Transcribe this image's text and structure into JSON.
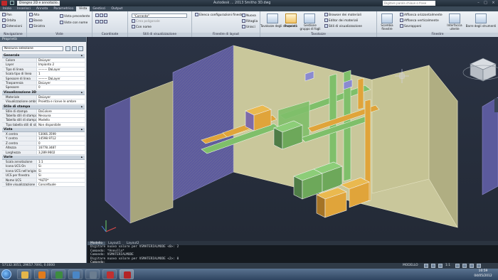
{
  "titlebar": {
    "workspace": "Disegno 2D e annotazio...",
    "title": "Autodesk ... 2013   Smitho 3D.dwg",
    "search_placeholder": "Digitare parola chiave o frase"
  },
  "tabs": [
    "Inizio",
    "Inserisci",
    "Annota",
    "Parametrico",
    "Vista",
    "Gestisci",
    "Output"
  ],
  "active_tab": "Vista",
  "ribbon": {
    "navigation": {
      "title": "Navigazione",
      "items": [
        "Pan",
        "Orbita",
        "Estensioni"
      ]
    },
    "views": {
      "title": "Viste",
      "items": [
        "Alto",
        "Basso",
        "Sinistra"
      ],
      "extras": [
        "Vista precedente",
        "Viste con nome"
      ]
    },
    "coords": {
      "title": "Coordinate"
    },
    "visual": {
      "title": "Stili di visualizzazione",
      "style": "\"Corrente\"",
      "items": [
        "Crea poligonale",
        "Con nome"
      ]
    },
    "viewports": {
      "title": "Finestre di layout",
      "items": [
        "Elenco configurazioni finestra",
        "Nuova",
        "Ritaglia",
        "Unisci"
      ]
    },
    "palettes": {
      "title": "Tavolozze",
      "items": [
        "Tavolozze degli strumenti",
        "Proprietà",
        "Gestione gruppo di fogli"
      ],
      "list": [
        "Browser dei materiali",
        "Editor dei materiali",
        "Stili di visualizzazione"
      ]
    },
    "windows": {
      "title": "Finestre",
      "items": [
        "Scambia finestre",
        "Affianca orizzontalmente",
        "Affianca verticalmente",
        "Sovrapponi",
        "Interfaccia utente",
        "Barre degli strumenti"
      ]
    }
  },
  "palette": {
    "title": "Proprietà",
    "selection": "Nessuna selezione",
    "sections": [
      {
        "name": "Generale",
        "rows": [
          [
            "Colore",
            "DaLayer"
          ],
          [
            "Layer",
            "Impianto 2"
          ],
          [
            "Tipo di linea",
            "——— DaLayer"
          ],
          [
            "Scala tipo di linea",
            "1"
          ],
          [
            "Spessore di linea",
            "——— DaLayer"
          ],
          [
            "Trasparenza",
            "DaLayer"
          ],
          [
            "Spessore",
            "0"
          ]
        ]
      },
      {
        "name": "Visualizzazione 3D",
        "rows": [
          [
            "Materiale",
            "DaLayer"
          ],
          [
            "Visualizzazione ombre",
            "Proietta e riceve le ombre"
          ]
        ]
      },
      {
        "name": "Stile di stampa",
        "rows": [
          [
            "Stile di stampa",
            "DaColore"
          ],
          [
            "Tabella stili di stampa",
            "Nessuna"
          ],
          [
            "Tabella stili di stampa",
            "Modello"
          ],
          [
            "Tipo tabella stili di sta...",
            "Non disponibile"
          ]
        ]
      },
      {
        "name": "Vista",
        "rows": [
          [
            "X centro",
            "53066.3599"
          ],
          [
            "Y centro",
            "14598.9712"
          ],
          [
            "Z centro",
            "0"
          ],
          [
            "Altezza",
            "16778.3487"
          ],
          [
            "Larghezza",
            "3,289.9602"
          ]
        ]
      },
      {
        "name": "Varie",
        "rows": [
          [
            "Scala annotazione",
            "1:1"
          ],
          [
            "Icona UCS On",
            "Sì"
          ],
          [
            "Icona UCS nell'origine",
            "Sì"
          ],
          [
            "UCS per finestra",
            "Sì"
          ],
          [
            "Nome UCS",
            "*ALTO*"
          ],
          [
            "Stile visualizzazione",
            "Concettuale"
          ]
        ]
      }
    ]
  },
  "viewport_tabs": [
    "Modello",
    "Layout1",
    "Layout2"
  ],
  "active_viewport_tab": "Modello",
  "command_lines": [
    "Digitare nuovo valore per VSMATERIALMODE <0>: 2",
    "Comando: *Annulla*",
    "Comando: VSMATERIALMODE",
    "Digitare nuovo valore per VSMATERIALMODE <2>: 0"
  ],
  "command_prompt": "Comando:",
  "status": {
    "coords": "57132.3051, 29657.7091, 0.0000",
    "mode": "MODELLO",
    "scale": "1:1"
  },
  "clock": {
    "time": "10:59",
    "date": "04/05/2012"
  },
  "taskbar_apps": [
    {
      "name": "explorer",
      "color": "#e5b64a"
    },
    {
      "name": "media-player",
      "color": "#e07b1c"
    },
    {
      "name": "chrome",
      "color": "#3d8c40"
    },
    {
      "name": "app-window",
      "color": "#4a86c5"
    },
    {
      "name": "app-window-2",
      "color": "#6b7d90"
    },
    {
      "name": "app-red",
      "color": "#c03030"
    },
    {
      "name": "autocad",
      "color": "#b42427"
    }
  ],
  "colors": {
    "wall": "#c9c79b",
    "duct": "#7fbf6a",
    "unit_orange": "#e0a43a",
    "unit_purple": "#7d6aa8",
    "unit_green": "#6da85a"
  }
}
